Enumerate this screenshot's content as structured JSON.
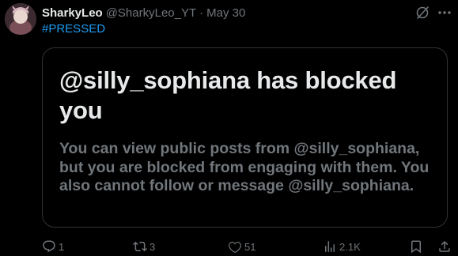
{
  "post": {
    "display_name": "SharkyLeo",
    "handle": "@SharkyLeo_YT",
    "separator": "·",
    "date": "May 30",
    "hashtag": "#PRESSED"
  },
  "embed": {
    "title": "@silly_sophiana has blocked you",
    "body": "You can view public posts from @silly_sophiana, but you are blocked from engaging with them. You also cannot follow or message @silly_sophiana."
  },
  "actions": {
    "replies": "1",
    "reposts": "3",
    "likes": "51",
    "views": "2.1K"
  },
  "icons": {
    "reply": "reply-icon",
    "repost": "repost-icon",
    "like": "heart-icon",
    "views": "views-chart-icon",
    "bookmark": "bookmark-icon",
    "share": "share-icon",
    "grok": "grok-icon"
  },
  "colors": {
    "background": "#000000",
    "text_primary": "#e7e9ea",
    "text_secondary": "#71767b",
    "link": "#1d9bf0",
    "border": "#2f3336"
  }
}
